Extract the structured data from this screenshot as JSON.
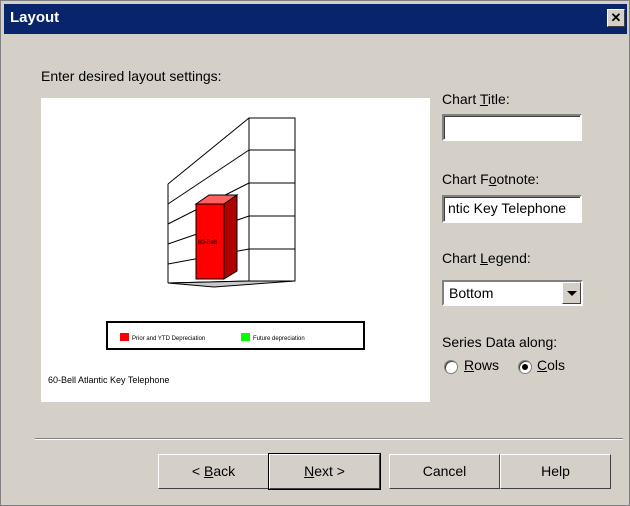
{
  "window": {
    "title": "Layout"
  },
  "instructions": "Enter desired layout settings:",
  "chart_preview": {
    "bar_label": "60-Bell",
    "legend": [
      "Prior and YTD Depreciation",
      "Future depreciation"
    ],
    "footnote": "60-Bell Atlantic Key Telephone",
    "colors": {
      "series1": "#ff0000",
      "series2": "#00ff00"
    }
  },
  "fields": {
    "chart_title": {
      "pre": "Chart ",
      "key": "T",
      "post": "itle:",
      "value": ""
    },
    "chart_footnote": {
      "pre": "Chart F",
      "key": "o",
      "post": "otnote:",
      "value": "ntic Key Telephone"
    },
    "chart_legend": {
      "pre": "Chart ",
      "key": "L",
      "post": "egend:",
      "value": "Bottom"
    },
    "series_data": {
      "label": "Series Data along:",
      "rows": {
        "key": "R",
        "post": "ows"
      },
      "cols": {
        "key": "C",
        "post": "ols"
      },
      "selected": "Cols"
    }
  },
  "buttons": {
    "back": {
      "pre": "< ",
      "key": "B",
      "post": "ack"
    },
    "next": {
      "key": "N",
      "post": "ext >"
    },
    "cancel": "Cancel",
    "help": "Help"
  }
}
